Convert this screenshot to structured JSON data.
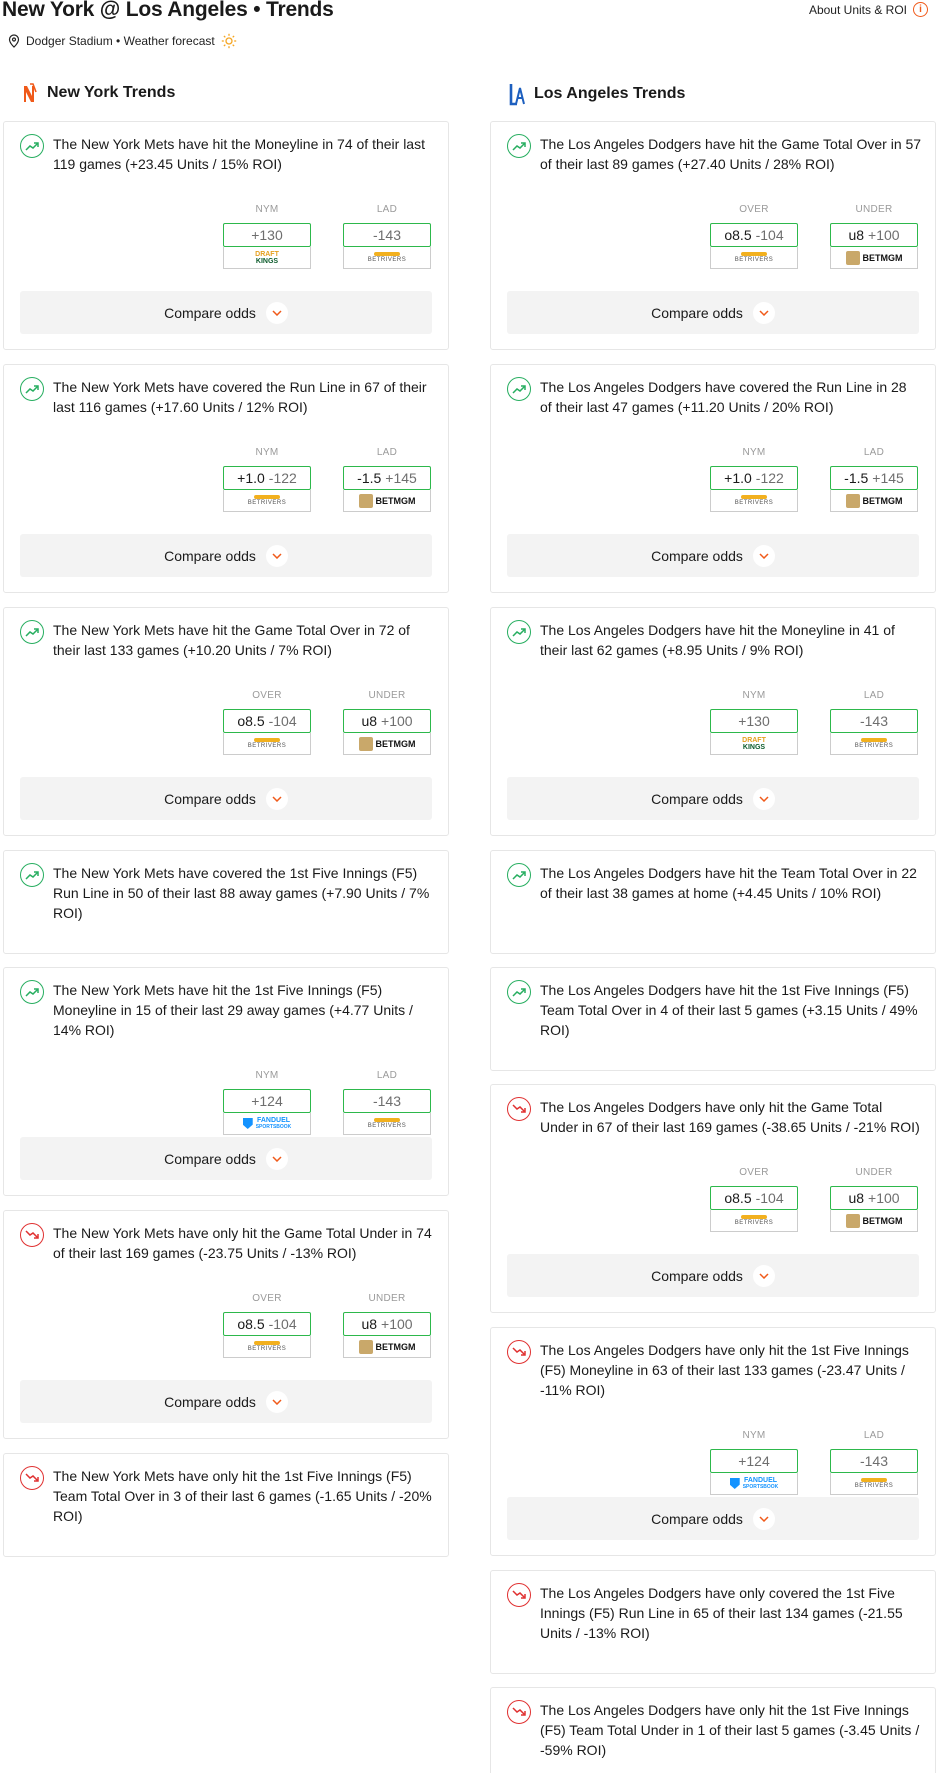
{
  "header": {
    "title": "New York @ Los Angeles • Trends",
    "about_label": "About Units & ROI",
    "subtitle": "Dodger Stadium • Weather forecast"
  },
  "compare_label": "Compare odds",
  "left": {
    "team_title": "New York Trends",
    "logo": "ny-logo-icon",
    "cards": [
      {
        "dir": "up",
        "text": "The New York Mets have hit the Moneyline in 74 of their last 119 games (+23.45 Units / 15% ROI)",
        "odds": [
          {
            "label": "NYM",
            "line": "",
            "price": "+130",
            "book": "draftkings"
          },
          {
            "label": "LAD",
            "line": "",
            "price": "-143",
            "book": "betrivers"
          }
        ]
      },
      {
        "dir": "up",
        "text": "The New York Mets have covered the Run Line in 67 of their last 116 games (+17.60 Units / 12% ROI)",
        "odds": [
          {
            "label": "NYM",
            "line": "+1.0",
            "price": "-122",
            "book": "betrivers"
          },
          {
            "label": "LAD",
            "line": "-1.5",
            "price": "+145",
            "book": "betmgm"
          }
        ]
      },
      {
        "dir": "up",
        "text": "The New York Mets have hit the Game Total Over in 72 of their last 133 games (+10.20 Units / 7% ROI)",
        "odds": [
          {
            "label": "OVER",
            "line": "o8.5",
            "price": "-104",
            "book": "betrivers"
          },
          {
            "label": "UNDER",
            "line": "u8",
            "price": "+100",
            "book": "betmgm"
          }
        ]
      },
      {
        "dir": "up",
        "text": "The New York Mets have covered the 1st Five Innings (F5) Run Line in 50 of their last 88 away games (+7.90 Units / 7% ROI)",
        "odds": []
      },
      {
        "dir": "up",
        "text": "The New York Mets have hit the 1st Five Innings (F5) Moneyline in 15 of their last 29 away games (+4.77 Units / 14% ROI)",
        "odds": [
          {
            "label": "NYM",
            "line": "",
            "price": "+124",
            "book": "fanduel"
          },
          {
            "label": "LAD",
            "line": "",
            "price": "-143",
            "book": "betrivers"
          }
        ]
      },
      {
        "dir": "down",
        "text": "The New York Mets have only hit the Game Total Under in 74 of their last 169 games (-23.75 Units / -13% ROI)",
        "odds": [
          {
            "label": "OVER",
            "line": "o8.5",
            "price": "-104",
            "book": "betrivers"
          },
          {
            "label": "UNDER",
            "line": "u8",
            "price": "+100",
            "book": "betmgm"
          }
        ]
      },
      {
        "dir": "down",
        "text": "The New York Mets have only hit the 1st Five Innings (F5) Team Total Over in 3 of their last 6 games (-1.65 Units / -20% ROI)",
        "odds": []
      }
    ]
  },
  "right": {
    "team_title": "Los Angeles Trends",
    "logo": "la-logo-icon",
    "cards": [
      {
        "dir": "up",
        "text": "The Los Angeles Dodgers have hit the Game Total Over in 57 of their last 89 games (+27.40 Units / 28% ROI)",
        "odds": [
          {
            "label": "OVER",
            "line": "o8.5",
            "price": "-104",
            "book": "betrivers"
          },
          {
            "label": "UNDER",
            "line": "u8",
            "price": "+100",
            "book": "betmgm"
          }
        ]
      },
      {
        "dir": "up",
        "text": "The Los Angeles Dodgers have covered the Run Line in 28 of their last 47 games (+11.20 Units / 20% ROI)",
        "odds": [
          {
            "label": "NYM",
            "line": "+1.0",
            "price": "-122",
            "book": "betrivers"
          },
          {
            "label": "LAD",
            "line": "-1.5",
            "price": "+145",
            "book": "betmgm"
          }
        ]
      },
      {
        "dir": "up",
        "text": "The Los Angeles Dodgers have hit the Moneyline in 41 of their last 62 games (+8.95 Units / 9% ROI)",
        "odds": [
          {
            "label": "NYM",
            "line": "",
            "price": "+130",
            "book": "draftkings"
          },
          {
            "label": "LAD",
            "line": "",
            "price": "-143",
            "book": "betrivers"
          }
        ]
      },
      {
        "dir": "up",
        "text": "The Los Angeles Dodgers have hit the Team Total Over in 22 of their last 38 games at home (+4.45 Units / 10% ROI)",
        "odds": []
      },
      {
        "dir": "up",
        "text": "The Los Angeles Dodgers have hit the 1st Five Innings (F5) Team Total Over in 4 of their last 5 games (+3.15 Units / 49% ROI)",
        "odds": []
      },
      {
        "dir": "down",
        "text": "The Los Angeles Dodgers have only hit the Game Total Under in 67 of their last 169 games (-38.65 Units / -21% ROI)",
        "odds": [
          {
            "label": "OVER",
            "line": "o8.5",
            "price": "-104",
            "book": "betrivers"
          },
          {
            "label": "UNDER",
            "line": "u8",
            "price": "+100",
            "book": "betmgm"
          }
        ]
      },
      {
        "dir": "down",
        "text": "The Los Angeles Dodgers have only hit the 1st Five Innings (F5) Moneyline in 63 of their last 133 games (-23.47 Units / -11% ROI)",
        "odds": [
          {
            "label": "NYM",
            "line": "",
            "price": "+124",
            "book": "fanduel"
          },
          {
            "label": "LAD",
            "line": "",
            "price": "-143",
            "book": "betrivers"
          }
        ]
      },
      {
        "dir": "down",
        "text": "The Los Angeles Dodgers have only covered the 1st Five Innings (F5) Run Line in 65 of their last 134 games (-21.55 Units / -13% ROI)",
        "odds": []
      },
      {
        "dir": "down",
        "text": "The Los Angeles Dodgers have only hit the 1st Five Innings (F5) Team Total Under in 1 of their last 5 games (-3.45 Units / -59% ROI)",
        "odds": []
      }
    ]
  },
  "books": {
    "draftkings": {
      "l1": "DRAFT",
      "l2": "KINGS"
    },
    "betrivers": {
      "text": "BETRIVERS"
    },
    "betmgm": {
      "text": "BETMGM"
    },
    "fanduel": {
      "l1": "FANDUEL",
      "l2": "SPORTSBOOK"
    }
  },
  "colors": {
    "up": "#27ae60",
    "down": "#e03131",
    "accent": "#f05a1a",
    "odds_border": "#2db84b"
  }
}
